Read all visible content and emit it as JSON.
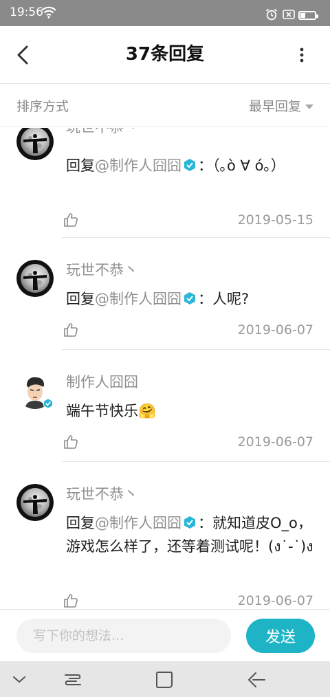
{
  "status_bar": {
    "time": "19:56",
    "battery_level": 0.35,
    "icons": [
      "wifi-icon",
      "alarm-icon",
      "sim-x-icon",
      "battery-icon"
    ]
  },
  "header": {
    "title": "37条回复",
    "back_icon": "chevron-left-icon",
    "more_icon": "vertical-dots-icon"
  },
  "sort": {
    "label": "排序方式",
    "selected": "最早回复"
  },
  "comments": [
    {
      "user": "玩世不恭丶",
      "prefix": "回复",
      "mention": "@制作人囧囧",
      "separator": "：",
      "text": "（｡ò ∀ ó｡）",
      "date": "2019-05-15"
    },
    {
      "user": "玩世不恭丶",
      "prefix": "回复",
      "mention": "@制作人囧囧",
      "separator": "：",
      "text": "人呢?",
      "date": "2019-06-07"
    },
    {
      "user": "制作人囧囧",
      "text": "端午节快乐",
      "emoji": "🤗",
      "date": "2019-06-07"
    },
    {
      "user": "玩世不恭丶",
      "prefix": "回复",
      "mention": "@制作人囧囧",
      "separator": "：",
      "text": "就知道皮O_o，游戏怎么样了，还等着测试呢！(ง˙-˙)ง",
      "date": "2019-06-07"
    }
  ],
  "input": {
    "placeholder": "写下你的想法...",
    "send_label": "发送"
  },
  "colors": {
    "accent": "#1eb4c6",
    "verified": "#29b6d9",
    "status_bar": "#8a8a8a",
    "muted_text": "#8f8f8f",
    "nav_bar": "#e6e6e6"
  },
  "nav_icons": [
    "chevron-down-icon",
    "recent-apps-icon",
    "home-icon",
    "back-icon"
  ]
}
